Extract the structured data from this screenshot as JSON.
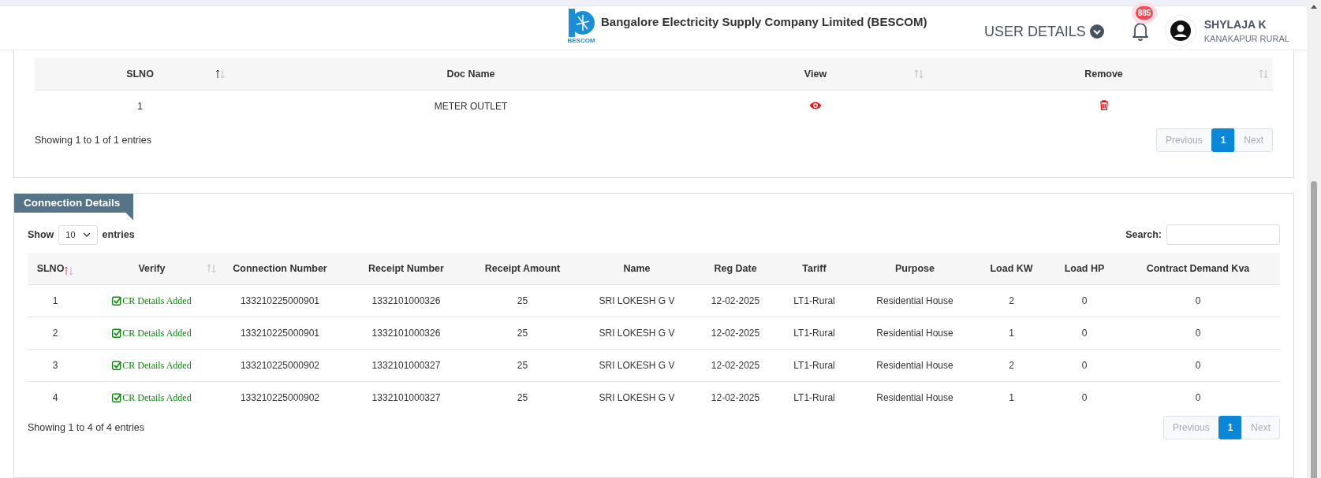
{
  "header": {
    "logo_caption": "BESCOM",
    "title": "Bangalore Electricity Supply Company Limited (BESCOM)",
    "menu_label": "USER DETAILS",
    "notification_count": "885",
    "user": {
      "name": "SHYLAJA K",
      "location": "KANAKAPUR RURAL"
    }
  },
  "documents": {
    "columns": [
      {
        "label": "SLNO",
        "sorted": true
      },
      {
        "label": "Doc Name"
      },
      {
        "label": "View",
        "sorted": false
      },
      {
        "label": "Remove",
        "sorted": false
      }
    ],
    "rows": [
      [
        {
          "kind": "text",
          "text": "1"
        },
        {
          "kind": "text",
          "text": "METER OUTLET"
        },
        {
          "kind": "view"
        },
        {
          "kind": "remove"
        }
      ]
    ],
    "info": "Showing 1 to 1 of 1 entries",
    "pagination": [
      {
        "label": "Previous",
        "selected": false,
        "disabled": true
      },
      {
        "label": "1",
        "selected": true,
        "disabled": false
      },
      {
        "label": "Next",
        "selected": false,
        "disabled": true
      }
    ]
  },
  "connection_details": {
    "title": "Connection Details",
    "show_label": "Show",
    "page_size": "10",
    "entries_label": "entries",
    "search_label": "Search:",
    "columns": [
      {
        "label": "SLNO",
        "kind": "text",
        "sorted": true
      },
      {
        "label": "Verify",
        "kind": "verify",
        "sorted": false
      },
      {
        "label": "Connection Number",
        "kind": "text"
      },
      {
        "label": "Receipt Number",
        "kind": "text"
      },
      {
        "label": "Receipt Amount",
        "kind": "text"
      },
      {
        "label": "Name",
        "kind": "text"
      },
      {
        "label": "Reg Date",
        "kind": "text"
      },
      {
        "label": "Tariff",
        "kind": "text"
      },
      {
        "label": "Purpose",
        "kind": "text"
      },
      {
        "label": "Load KW",
        "kind": "text"
      },
      {
        "label": "Load HP",
        "kind": "text"
      },
      {
        "label": "Contract Demand Kva",
        "kind": "text"
      }
    ],
    "rows": [
      [
        "1",
        "CR Details Added",
        "133210225000901",
        "1332101000326",
        "25",
        "SRI LOKESH G V",
        "12-02-2025",
        "LT1-Rural",
        "Residential House",
        "2",
        "0",
        "0"
      ],
      [
        "2",
        "CR Details Added",
        "133210225000901",
        "1332101000326",
        "25",
        "SRI LOKESH G V",
        "12-02-2025",
        "LT1-Rural",
        "Residential House",
        "1",
        "0",
        "0"
      ],
      [
        "3",
        "CR Details Added",
        "133210225000902",
        "1332101000327",
        "25",
        "SRI LOKESH G V",
        "12-02-2025",
        "LT1-Rural",
        "Residential House",
        "2",
        "0",
        "0"
      ],
      [
        "4",
        "CR Details Added",
        "133210225000902",
        "1332101000327",
        "25",
        "SRI LOKESH G V",
        "12-02-2025",
        "LT1-Rural",
        "Residential House",
        "1",
        "0",
        "0"
      ]
    ],
    "info": "Showing 1 to 4 of 4 entries",
    "pagination": [
      {
        "label": "Previous",
        "selected": false,
        "disabled": true
      },
      {
        "label": "1",
        "selected": true,
        "disabled": false
      },
      {
        "label": "Next",
        "selected": false,
        "disabled": true
      }
    ]
  }
}
